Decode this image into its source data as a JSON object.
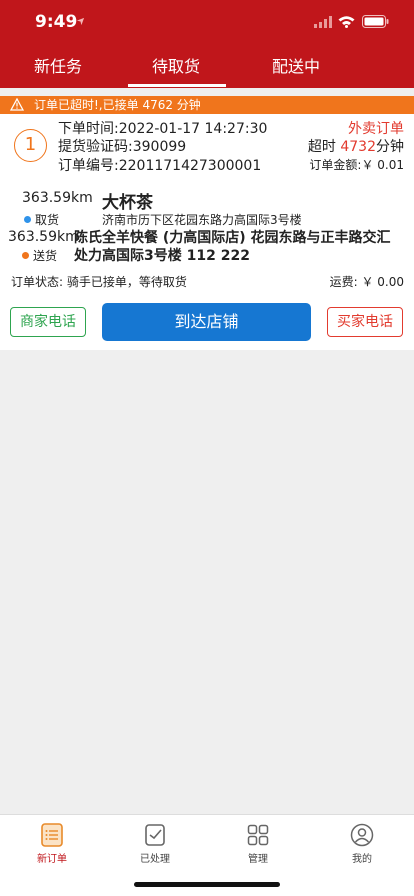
{
  "status_bar": {
    "time": "9:49"
  },
  "tabs": [
    {
      "label": "新任务"
    },
    {
      "label": "待取货"
    },
    {
      "label": "配送中"
    }
  ],
  "alert": {
    "text": "订单已超时!,已接单 4762 分钟"
  },
  "order": {
    "index": "1",
    "order_time": "下单时间:2022-01-17 14:27:30",
    "pickup_code": "提货验证码:390099",
    "order_number": "订单编号:2201171427300001",
    "type": "外卖订单",
    "overtime_prefix": "超时",
    "overtime_value": "4732",
    "overtime_unit": "分钟",
    "amount": "订单金额:￥ 0.01",
    "shop_distance": "363.59km",
    "shop_name": "大杯茶",
    "pickup_label": "取货",
    "shop_address": "济南市历下区花园东路力高国际3号楼",
    "customer_distance": "363.59km",
    "delivery_label": "送货",
    "customer_address": "陈氏全羊快餐 (力高国际店) 花园东路与正丰路交汇处力高国际3号楼 112 222",
    "status": "订单状态: 骑手已接单，等待取货",
    "fee": "运费: ￥ 0.00",
    "merchant_phone_label": "商家电话",
    "arrive_label": "到达店铺",
    "buyer_phone_label": "买家电话"
  },
  "bottom_nav": [
    {
      "label": "新订单",
      "icon": "new-orders-icon"
    },
    {
      "label": "已处理",
      "icon": "processed-icon"
    },
    {
      "label": "管理",
      "icon": "manage-icon"
    },
    {
      "label": "我的",
      "icon": "profile-icon"
    }
  ],
  "colors": {
    "primary": "#c0161b",
    "alert": "#f0751c",
    "button": "#1677d2",
    "green": "#2ea44f"
  }
}
